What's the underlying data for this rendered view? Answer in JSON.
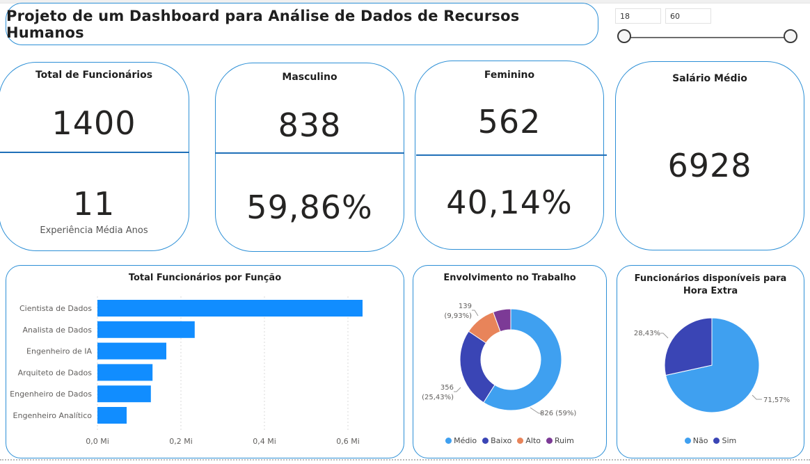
{
  "title": "Projeto de um Dashboard para Análise de Dados de Recursos Humanos",
  "slicer": {
    "min": "18",
    "max": "60",
    "range": [
      18,
      60
    ]
  },
  "kpis": {
    "total": {
      "title": "Total de Funcionários",
      "value": "1400",
      "sub_value": "11",
      "sub_label": "Experiência Média Anos"
    },
    "masculino": {
      "title": "Masculino",
      "value": "838",
      "pct": "59,86%"
    },
    "feminino": {
      "title": "Feminino",
      "value": "562",
      "pct": "40,14%"
    },
    "salario": {
      "title": "Salário Médio",
      "value": "6928"
    }
  },
  "colors": {
    "accent": "#2c8fd6",
    "bar": "#118dff",
    "medio": "#3fa0f0",
    "baixo": "#3a45b5",
    "alto": "#e8845a",
    "ruim": "#7c3a96",
    "nao": "#3fa0f0",
    "sim": "#3a45b5"
  },
  "chart_data": [
    {
      "type": "bar",
      "orientation": "horizontal",
      "title": "Total Funcionários por Função",
      "categories": [
        "Cientista de Dados",
        "Analista de Dados",
        "Engenheiro de IA",
        "Arquiteto de Dados",
        "Engenheiro de Dados",
        "Engenheiro Analítico"
      ],
      "values": [
        0.635,
        0.233,
        0.165,
        0.132,
        0.128,
        0.07
      ],
      "xlim": [
        0,
        0.65
      ],
      "xticks": [
        0,
        0.2,
        0.4,
        0.6
      ],
      "xtick_labels": [
        "0,0 Mi",
        "0,2 Mi",
        "0,4 Mi",
        "0,6 Mi"
      ],
      "grid": true
    },
    {
      "type": "pie",
      "donut": true,
      "title": "Envolvimento no Trabalho",
      "labels": [
        "Médio",
        "Baixo",
        "Alto",
        "Ruim"
      ],
      "values": [
        826,
        356,
        139,
        79
      ],
      "data_labels": {
        "Médio": "826 (59%)",
        "Baixo": [
          "356",
          "(25,43%)"
        ],
        "Alto": [
          "139",
          "(9,93%)"
        ]
      },
      "legend": "bottom"
    },
    {
      "type": "pie",
      "title": "Funcionários disponíveis para Hora Extra",
      "labels": [
        "Não",
        "Sim"
      ],
      "values": [
        71.57,
        28.43
      ],
      "data_labels": {
        "Não": "71,57%",
        "Sim": "28,43%"
      },
      "legend": "bottom"
    }
  ]
}
